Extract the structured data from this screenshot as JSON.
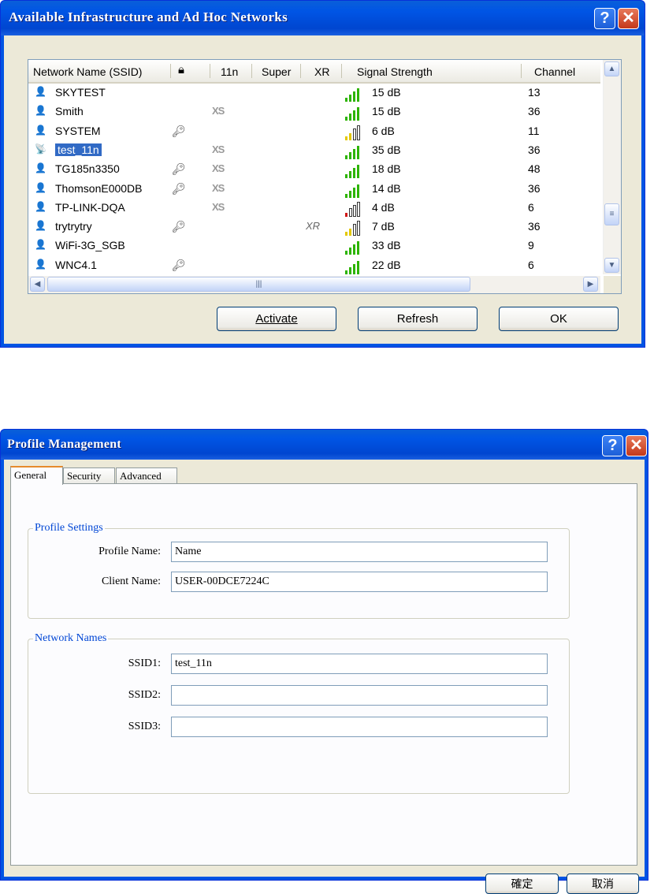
{
  "window1": {
    "title": "Available Infrastructure and Ad Hoc Networks",
    "help_label": "?",
    "close_label": "✕",
    "columns": [
      "Network Name (SSID)",
      "11n",
      "Super",
      "XR",
      "Signal Strength",
      "Channel"
    ],
    "lock_column_icon": "lock-icon",
    "rows": [
      {
        "ssid": "SKYTEST",
        "encrypted": false,
        "xs": false,
        "xr": false,
        "bars": 4,
        "signal": "15 dB",
        "channel": "13"
      },
      {
        "ssid": "Smith",
        "encrypted": false,
        "xs": true,
        "xr": false,
        "bars": 4,
        "signal": "15 dB",
        "channel": "36"
      },
      {
        "ssid": "SYSTEM",
        "encrypted": true,
        "xs": false,
        "xr": false,
        "bars": 2,
        "signal": "6 dB",
        "channel": "11"
      },
      {
        "ssid": "test_11n",
        "encrypted": false,
        "xs": true,
        "xr": false,
        "bars": 4,
        "signal": "35 dB",
        "channel": "36",
        "selected": true
      },
      {
        "ssid": "TG185n3350",
        "encrypted": true,
        "xs": true,
        "xr": false,
        "bars": 4,
        "signal": "18 dB",
        "channel": "48"
      },
      {
        "ssid": "ThomsonE000DB",
        "encrypted": true,
        "xs": true,
        "xr": false,
        "bars": 4,
        "signal": "14 dB",
        "channel": "36"
      },
      {
        "ssid": "TP-LINK-DQA",
        "encrypted": false,
        "xs": true,
        "xr": false,
        "bars": 1,
        "signal": "4 dB",
        "channel": "6"
      },
      {
        "ssid": "trytrytry",
        "encrypted": true,
        "xs": false,
        "xr": true,
        "bars": 2,
        "signal": "7 dB",
        "channel": "36"
      },
      {
        "ssid": "WiFi-3G_SGB",
        "encrypted": false,
        "xs": false,
        "xr": false,
        "bars": 4,
        "signal": "33 dB",
        "channel": "9"
      },
      {
        "ssid": "WNC4.1",
        "encrypted": true,
        "xs": false,
        "xr": false,
        "bars": 4,
        "signal": "22 dB",
        "channel": "6"
      }
    ],
    "xs_label": "XS",
    "xr_label": "XR",
    "buttons": {
      "activate": "Activate",
      "refresh": "Refresh",
      "ok": "OK"
    },
    "colors": {
      "bar_green": "#2db400",
      "bar_yellow": "#e3c800",
      "bar_red": "#d01818",
      "selection": "#316ac5"
    }
  },
  "window2": {
    "title": "Profile Management",
    "help_label": "?",
    "close_label": "✕",
    "tabs": [
      "General",
      "Security",
      "Advanced"
    ],
    "profile_settings": {
      "title": "Profile Settings",
      "profile_name_label": "Profile Name:",
      "profile_name_value": "Name",
      "client_name_label": "Client Name:",
      "client_name_value": "USER-00DCE7224C"
    },
    "network_names": {
      "title": "Network Names",
      "ssid1_label": "SSID1:",
      "ssid1_value": "test_11n",
      "ssid2_label": "SSID2:",
      "ssid2_value": "",
      "ssid3_label": "SSID3:",
      "ssid3_value": ""
    },
    "buttons": {
      "ok": "確定",
      "cancel": "取消"
    }
  }
}
